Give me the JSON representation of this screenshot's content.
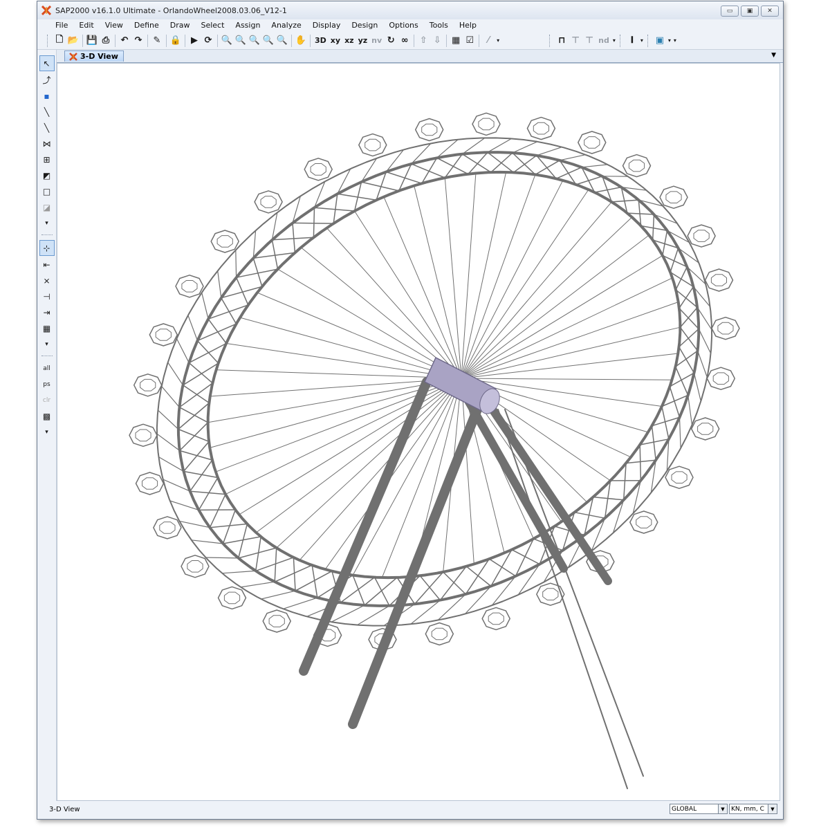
{
  "window": {
    "title": "SAP2000 v16.1.0 Ultimate  - OrlandoWheel2008.03.06_V12-1",
    "controls": {
      "minimize": "▭",
      "maximize": "▣",
      "close": "✕"
    }
  },
  "menu": [
    "File",
    "Edit",
    "View",
    "Define",
    "Draw",
    "Select",
    "Assign",
    "Analyze",
    "Display",
    "Design",
    "Options",
    "Tools",
    "Help"
  ],
  "toolbar": {
    "xy": "xy",
    "xz": "xz",
    "yz": "yz",
    "nv": "nv",
    "nd": "nd",
    "three_d": "3D"
  },
  "tab": {
    "label": "3-D View",
    "menu_arrow": "▼"
  },
  "status": {
    "view_label": "3-D View",
    "coord_system": "GLOBAL",
    "units": "KN, mm, C"
  },
  "colors": {
    "structure": "#707070",
    "hub": "#a9a3c4",
    "accent": "#d94b1f"
  }
}
